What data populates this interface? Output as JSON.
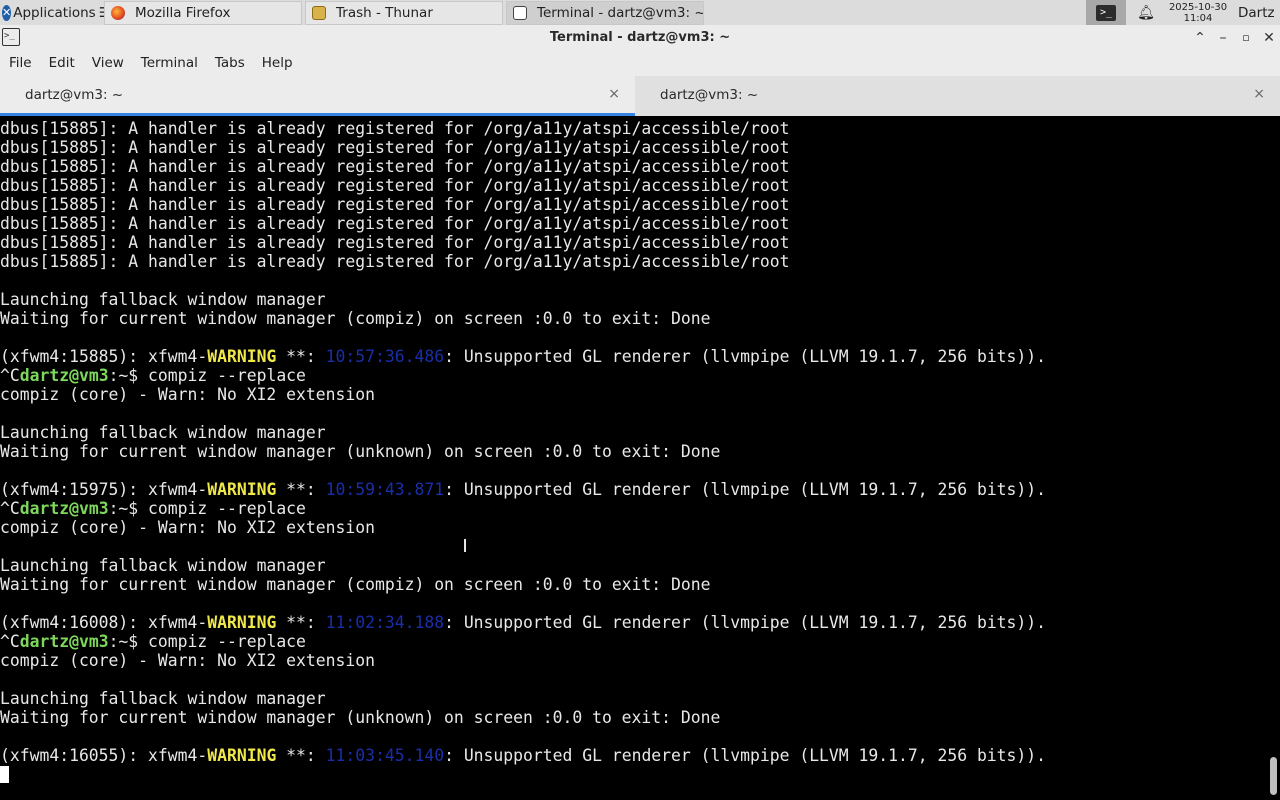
{
  "panel": {
    "applications_label": "Applications",
    "tasks": [
      {
        "label": "Mozilla Firefox",
        "icon": "firefox-icon",
        "active": false
      },
      {
        "label": "Trash - Thunar",
        "icon": "thunar-icon",
        "active": false
      },
      {
        "label": "Terminal - dartz@vm3: ~",
        "icon": "terminal-icon",
        "active": true
      }
    ],
    "clock_date": "2025-10-30",
    "clock_time": "11:04",
    "user": "Dartz"
  },
  "window": {
    "title": "Terminal - dartz@vm3: ~"
  },
  "menubar": {
    "items": [
      "File",
      "Edit",
      "View",
      "Terminal",
      "Tabs",
      "Help"
    ]
  },
  "tabs": [
    {
      "label": "dartz@vm3: ~",
      "active": true
    },
    {
      "label": "dartz@vm3: ~",
      "active": false
    }
  ],
  "terminal": {
    "lines": [
      [
        {
          "t": "dbus[15885]: A handler is already registered for /org/a11y/atspi/accessible/root"
        }
      ],
      [
        {
          "t": "dbus[15885]: A handler is already registered for /org/a11y/atspi/accessible/root"
        }
      ],
      [
        {
          "t": "dbus[15885]: A handler is already registered for /org/a11y/atspi/accessible/root"
        }
      ],
      [
        {
          "t": "dbus[15885]: A handler is already registered for /org/a11y/atspi/accessible/root"
        }
      ],
      [
        {
          "t": "dbus[15885]: A handler is already registered for /org/a11y/atspi/accessible/root"
        }
      ],
      [
        {
          "t": "dbus[15885]: A handler is already registered for /org/a11y/atspi/accessible/root"
        }
      ],
      [
        {
          "t": "dbus[15885]: A handler is already registered for /org/a11y/atspi/accessible/root"
        }
      ],
      [
        {
          "t": "dbus[15885]: A handler is already registered for /org/a11y/atspi/accessible/root"
        }
      ],
      [
        {
          "t": ""
        }
      ],
      [
        {
          "t": "Launching fallback window manager"
        }
      ],
      [
        {
          "t": "Waiting for current window manager (compiz) on screen :0.0 to exit: Done"
        }
      ],
      [
        {
          "t": ""
        }
      ],
      [
        {
          "t": "(xfwm4:15885): xfwm4-"
        },
        {
          "t": "WARNING",
          "c": "warn"
        },
        {
          "t": " **: "
        },
        {
          "t": "10:57:36.486",
          "c": "ts"
        },
        {
          "t": ": Unsupported GL renderer (llvmpipe (LLVM 19.1.7, 256 bits))."
        }
      ],
      [
        {
          "t": "^C"
        },
        {
          "t": "dartz@vm3",
          "c": "prompt"
        },
        {
          "t": ":~$ compiz --replace"
        }
      ],
      [
        {
          "t": "compiz (core) - Warn: No XI2 extension"
        }
      ],
      [
        {
          "t": ""
        }
      ],
      [
        {
          "t": "Launching fallback window manager"
        }
      ],
      [
        {
          "t": "Waiting for current window manager (unknown) on screen :0.0 to exit: Done"
        }
      ],
      [
        {
          "t": ""
        }
      ],
      [
        {
          "t": "(xfwm4:15975): xfwm4-"
        },
        {
          "t": "WARNING",
          "c": "warn"
        },
        {
          "t": " **: "
        },
        {
          "t": "10:59:43.871",
          "c": "ts"
        },
        {
          "t": ": Unsupported GL renderer (llvmpipe (LLVM 19.1.7, 256 bits))."
        }
      ],
      [
        {
          "t": "^C"
        },
        {
          "t": "dartz@vm3",
          "c": "prompt"
        },
        {
          "t": ":~$ compiz --replace"
        }
      ],
      [
        {
          "t": "compiz (core) - Warn: No XI2 extension"
        }
      ],
      [
        {
          "t": ""
        }
      ],
      [
        {
          "t": "Launching fallback window manager"
        }
      ],
      [
        {
          "t": "Waiting for current window manager (compiz) on screen :0.0 to exit: Done"
        }
      ],
      [
        {
          "t": ""
        }
      ],
      [
        {
          "t": "(xfwm4:16008): xfwm4-"
        },
        {
          "t": "WARNING",
          "c": "warn"
        },
        {
          "t": " **: "
        },
        {
          "t": "11:02:34.188",
          "c": "ts"
        },
        {
          "t": ": Unsupported GL renderer (llvmpipe (LLVM 19.1.7, 256 bits))."
        }
      ],
      [
        {
          "t": "^C"
        },
        {
          "t": "dartz@vm3",
          "c": "prompt"
        },
        {
          "t": ":~$ compiz --replace"
        }
      ],
      [
        {
          "t": "compiz (core) - Warn: No XI2 extension"
        }
      ],
      [
        {
          "t": ""
        }
      ],
      [
        {
          "t": "Launching fallback window manager"
        }
      ],
      [
        {
          "t": "Waiting for current window manager (unknown) on screen :0.0 to exit: Done"
        }
      ],
      [
        {
          "t": ""
        }
      ],
      [
        {
          "t": "(xfwm4:16055): xfwm4-"
        },
        {
          "t": "WARNING",
          "c": "warn"
        },
        {
          "t": " **: "
        },
        {
          "t": "11:03:45.140",
          "c": "ts"
        },
        {
          "t": ": Unsupported GL renderer (llvmpipe (LLVM 19.1.7, 256 bits))."
        }
      ]
    ]
  },
  "colors": {
    "warning": "#f0e84a",
    "prompt": "#7dd85c",
    "timestamp": "#1a2ea8",
    "tab_accent": "#3584e4"
  }
}
